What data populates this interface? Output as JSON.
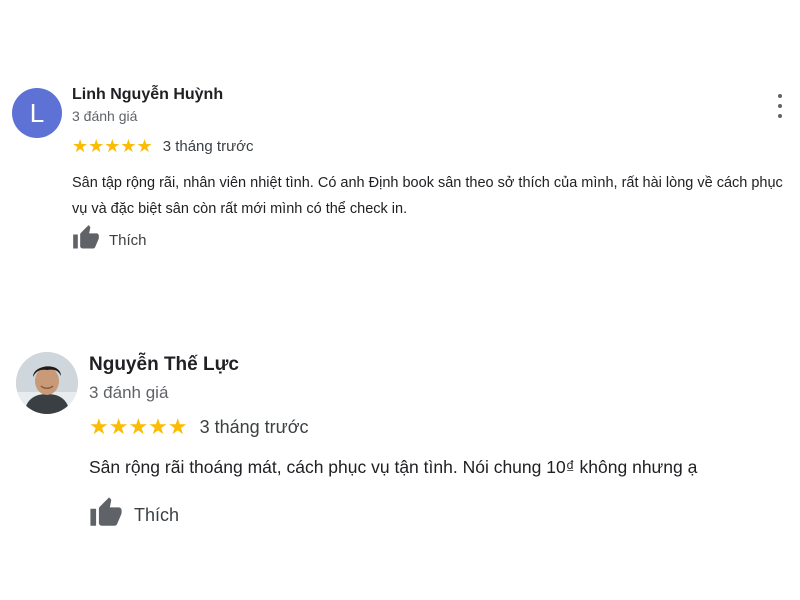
{
  "reviews": [
    {
      "author": "Linh Nguyễn Huỳnh",
      "avatar_letter": "L",
      "avatar_color": "#5e72d6",
      "review_count": "3 đánh giá",
      "stars": "★★★★★",
      "rating": 5,
      "time": "3 tháng trước",
      "text": "Sân tập rộng rãi, nhân viên nhiệt tình.  Có anh Định book sân theo sở thích của mình, rất hài lòng về cách phục vụ và đặc biệt sân còn rất mới mình có thể check in.",
      "like_label": "Thích",
      "icons": {
        "like": "thumbs-up-icon",
        "menu": "more-vert-icon"
      }
    },
    {
      "author": "Nguyễn Thế Lực",
      "avatar_image": "profile-photo",
      "review_count": "3 đánh giá",
      "stars": "★★★★★",
      "rating": 5,
      "time": "3 tháng trước",
      "text": "Sân rộng rãi thoáng mát, cách phục vụ tận tình. Nói chung 10₫ không nhưng ạ",
      "like_label": "Thích",
      "icons": {
        "like": "thumbs-up-icon"
      }
    }
  ],
  "colors": {
    "star": "#fbbc04",
    "secondary_text": "#5f6368",
    "primary_text": "#202124",
    "icon": "#5f6368"
  }
}
